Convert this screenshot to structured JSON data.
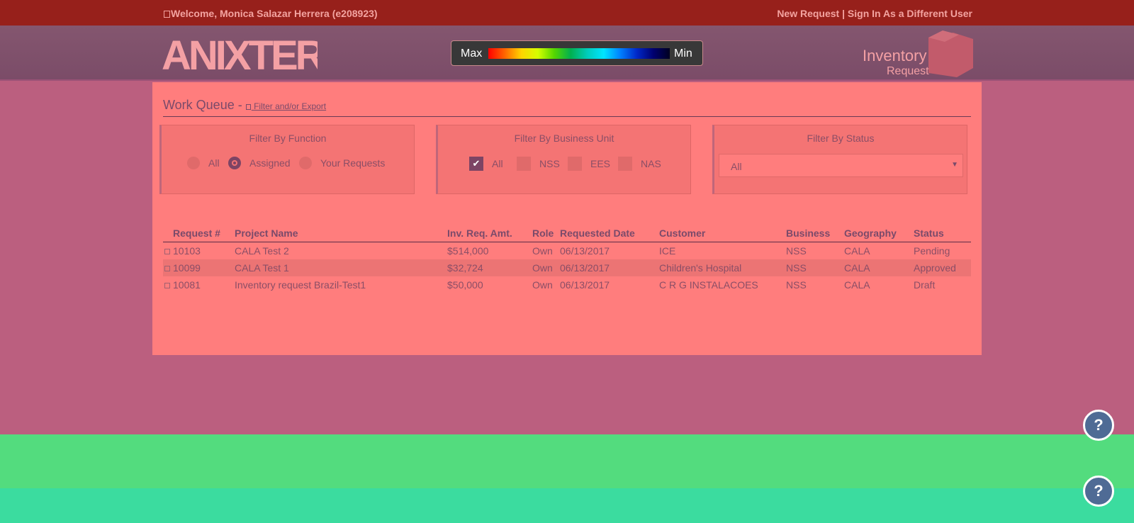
{
  "topbar": {
    "welcome": "Welcome, Monica Salazar Herrera (e208923)",
    "links": "New Request | Sign In As a Different User"
  },
  "header": {
    "logo_text": "ANIXTER",
    "legend_max": "Max",
    "legend_min": "Min",
    "app_title_line1": "Inventory",
    "app_title_line2": "Request"
  },
  "work_queue": {
    "title": "Work Queue -",
    "filter_link": "Filter and/or Export"
  },
  "filters": {
    "function": {
      "title": "Filter By Function",
      "options": [
        "All",
        "Assigned",
        "Your Requests"
      ],
      "selected": "Assigned"
    },
    "business_unit": {
      "title": "Filter By Business Unit",
      "options": [
        "All",
        "NSS",
        "EES",
        "NAS"
      ],
      "checked": [
        "All"
      ]
    },
    "status": {
      "title": "Filter By Status",
      "value": "All"
    }
  },
  "table": {
    "headers": [
      "Request #",
      "Project Name",
      "Inv. Req. Amt.",
      "Role",
      "Requested Date",
      "Customer",
      "Business",
      "Geography",
      "Status"
    ],
    "rows": [
      [
        "10103",
        "CALA Test 2",
        "$514,000",
        "Own",
        "06/13/2017",
        "ICE",
        "NSS",
        "CALA",
        "Pending"
      ],
      [
        "10099",
        "CALA Test 1",
        "$32,724",
        "Own",
        "06/13/2017",
        "Children's Hospital",
        "NSS",
        "CALA",
        "Approved"
      ],
      [
        "10081",
        "Inventory request Brazil-Test1",
        "$50,000",
        "Own",
        "06/13/2017",
        "C R G INSTALACOES",
        "NSS",
        "CALA",
        "Draft"
      ]
    ]
  },
  "help_buttons": [
    "?",
    "?"
  ],
  "colors": {
    "topbar": "#97201b",
    "panel": "#ff7d7d",
    "accent": "#7d4464",
    "help": "#4f6b95"
  }
}
